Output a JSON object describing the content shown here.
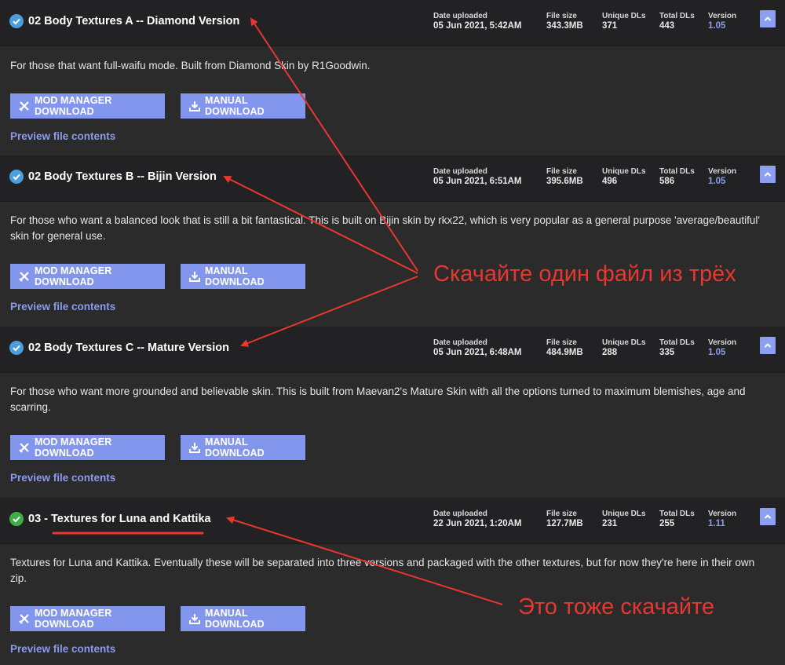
{
  "labels": {
    "date": "Date uploaded",
    "size": "File size",
    "uniq": "Unique DLs",
    "total": "Total DLs",
    "version": "Version",
    "mm_download": "MOD MANAGER DOWNLOAD",
    "manual_download": "MANUAL DOWNLOAD",
    "preview": "Preview file contents"
  },
  "files": [
    {
      "title": "02 Body Textures A -- Diamond Version",
      "date": "05 Jun 2021, 5:42AM",
      "size": "343.3MB",
      "unique_dls": "371",
      "total_dls": "443",
      "version": "1.05",
      "description": "For those that want full-waifu mode. Built from Diamond Skin by R1Goodwin.",
      "check_color": "#4a9ee0"
    },
    {
      "title": "02 Body Textures B -- Bijin Version",
      "date": "05 Jun 2021, 6:51AM",
      "size": "395.6MB",
      "unique_dls": "496",
      "total_dls": "586",
      "version": "1.05",
      "description": "For those who want a balanced look that is still a bit fantastical. This is built on Bijin skin by rkx22, which is very popular as a general purpose 'average/beautiful' skin for general use.",
      "check_color": "#4a9ee0"
    },
    {
      "title": "02 Body Textures C -- Mature Version",
      "date": "05 Jun 2021, 6:48AM",
      "size": "484.9MB",
      "unique_dls": "288",
      "total_dls": "335",
      "version": "1.05",
      "description": "For those who want more grounded and believable skin. This is built from Maevan2's Mature Skin with all the options turned to maximum blemishes, age and scarring.",
      "check_color": "#4a9ee0"
    },
    {
      "title": "03 - Textures for Luna and Kattika",
      "date": "22 Jun 2021, 1:20AM",
      "size": "127.7MB",
      "unique_dls": "231",
      "total_dls": "255",
      "version": "1.11",
      "description": "Textures for Luna and Kattika. Eventually these will be separated into three versions and packaged with the other textures, but for now they're here in their own zip.",
      "check_color": "#3fae4a"
    }
  ],
  "annotations": {
    "pick_one": "Скачайте один файл из трёх",
    "also_download": "Это тоже скачайте",
    "color": "#e8372f"
  },
  "icons": {
    "check": "check-circle-icon",
    "collapse": "chevron-up-icon",
    "mod_manager": "mod-manager-icon",
    "manual": "download-icon"
  }
}
